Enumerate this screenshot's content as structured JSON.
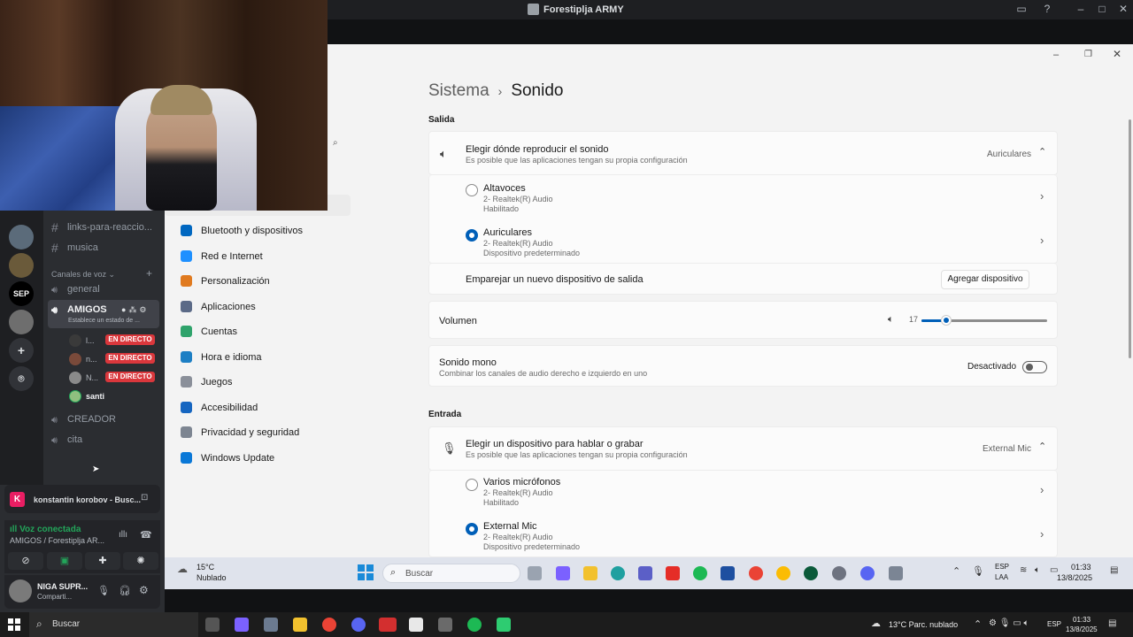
{
  "window": {
    "title": "Forestiplja ARMY"
  },
  "discord": {
    "channels_top": [
      "links-para-reaccio...",
      "musica"
    ],
    "voice_section": "Canales de voz",
    "voice_channels": {
      "general": "general",
      "amigos": "AMIGOS",
      "amigos_status": "Establece un estado de ...",
      "creador": "CREADOR",
      "cita": "cita"
    },
    "voice_users": [
      {
        "name": "l...",
        "live": "EN DIRECTO"
      },
      {
        "name": "n...",
        "live": "EN DIRECTO"
      },
      {
        "name": "N...",
        "live": "EN DIRECTO"
      },
      {
        "name": "santi",
        "live": ""
      }
    ],
    "servers": [
      {
        "label": "SEP"
      }
    ],
    "activity": {
      "text": "konstantin korobov - Busc...",
      "avatar_letter": "K"
    },
    "voice_status": {
      "title": "Voz conectada",
      "channel": "AMIGOS / Forestiplja AR..."
    },
    "user": {
      "name": "NIGA SUPR...",
      "status": "Comparti..."
    }
  },
  "settings": {
    "breadcrumb_parent": "Sistema",
    "breadcrumb_sep": "›",
    "page_title": "Sonido",
    "nav": [
      {
        "label": "Bluetooth y dispositivos",
        "color": "#0067c0"
      },
      {
        "label": "Red e Internet",
        "color": "#1e90ff"
      },
      {
        "label": "Personalización",
        "color": "#e07a1f"
      },
      {
        "label": "Aplicaciones",
        "color": "#5b6a87"
      },
      {
        "label": "Cuentas",
        "color": "#2fa36b"
      },
      {
        "label": "Hora e idioma",
        "color": "#1d7fc4"
      },
      {
        "label": "Juegos",
        "color": "#8a8f99"
      },
      {
        "label": "Accesibilidad",
        "color": "#1565c0"
      },
      {
        "label": "Privacidad y seguridad",
        "color": "#7d8591"
      },
      {
        "label": "Windows Update",
        "color": "#0a78d7"
      }
    ],
    "output": {
      "section": "Salida",
      "choose_title": "Elegir dónde reproducir el sonido",
      "choose_sub": "Es posible que las aplicaciones tengan su propia configuración",
      "selected": "Auriculares",
      "devices": [
        {
          "name": "Altavoces",
          "driver": "2- Realtek(R) Audio",
          "state": "Habilitado",
          "selected": false
        },
        {
          "name": "Auriculares",
          "driver": "2- Realtek(R) Audio",
          "state": "Dispositivo predeterminado",
          "selected": true
        }
      ],
      "pair_text": "Emparejar un nuevo dispositivo de salida",
      "add_button": "Agregar dispositivo",
      "volume_label": "Volumen",
      "volume_value": "17",
      "volume_fraction": 0.2,
      "mono_title": "Sonido mono",
      "mono_sub": "Combinar los canales de audio derecho e izquierdo en uno",
      "mono_state": "Desactivado"
    },
    "input": {
      "section": "Entrada",
      "choose_title": "Elegir un dispositivo para hablar o grabar",
      "choose_sub": "Es posible que las aplicaciones tengan su propia configuración",
      "selected": "External Mic",
      "devices": [
        {
          "name": "Varios micrófonos",
          "driver": "2- Realtek(R) Audio",
          "state": "Habilitado",
          "selected": false
        },
        {
          "name": "External Mic",
          "driver": "2- Realtek(R) Audio",
          "state": "Dispositivo predeterminado",
          "selected": true
        }
      ]
    }
  },
  "taskbar_inner": {
    "weather_temp": "15°C",
    "weather_desc": "Nublado",
    "search": "Buscar",
    "lang": "ESP",
    "lang_sub": "LAA",
    "time": "01:33",
    "date": "13/8/2025"
  },
  "taskbar_outer": {
    "search": "Buscar",
    "weather": "13°C Parc. nublado",
    "lang": "ESP",
    "time": "01:33",
    "date": "13/8/2025"
  },
  "colors": {
    "accent": "#005fb8",
    "live_red": "#da373c",
    "discord_bg": "#2b2d31"
  }
}
